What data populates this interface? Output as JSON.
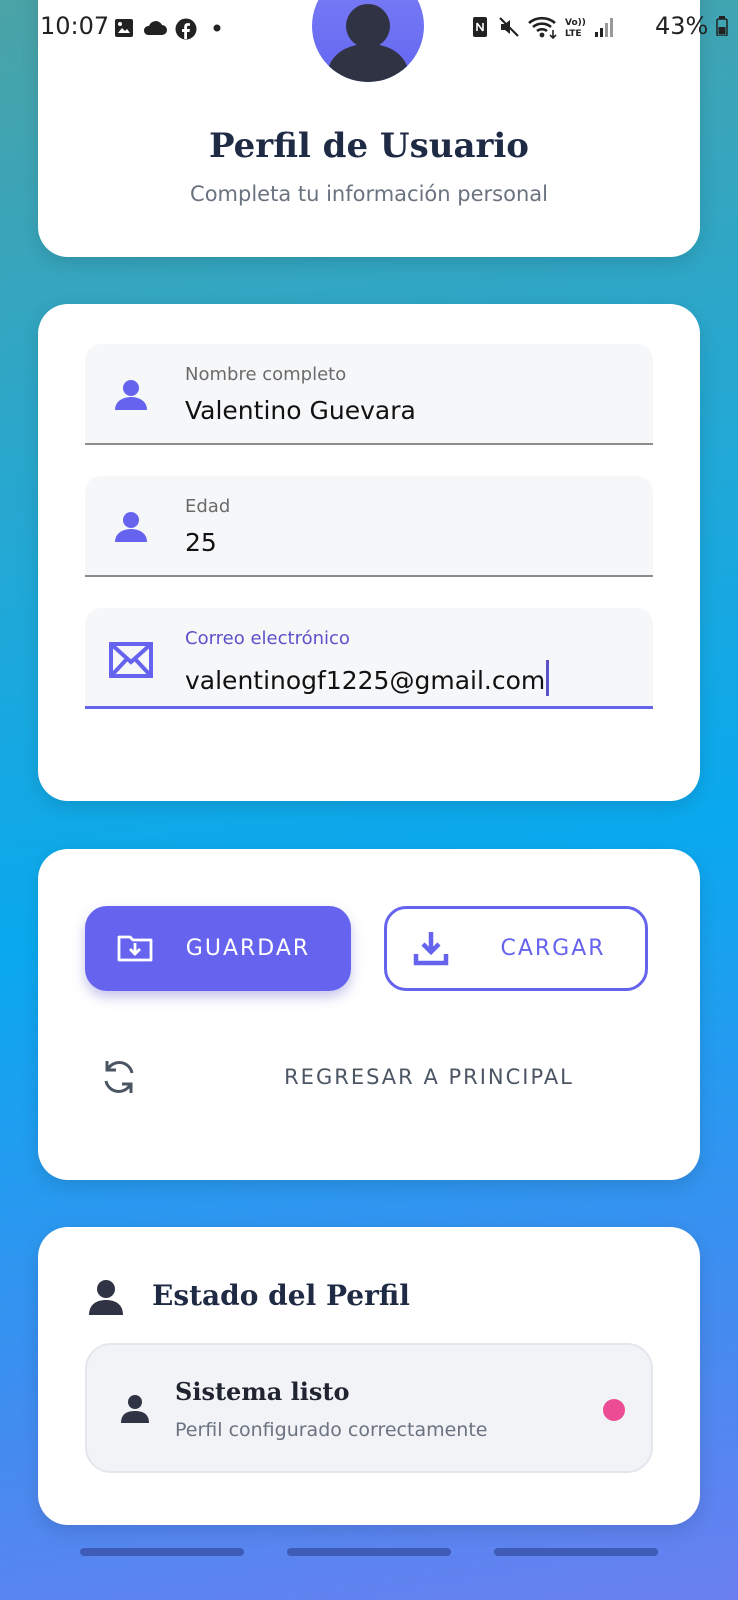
{
  "status_bar": {
    "time": "10:07",
    "battery": "43%",
    "icons": [
      "gallery-icon",
      "cloud-icon",
      "facebook-icon",
      "dot-icon",
      "nfc-icon",
      "mute-icon",
      "wifi-icon",
      "volte-icon",
      "signal-icon",
      "battery-icon"
    ]
  },
  "header": {
    "title": "Perfil de Usuario",
    "subtitle": "Completa tu información personal",
    "avatar_icon": "person-icon"
  },
  "form": {
    "name": {
      "label": "Nombre completo",
      "value": "Valentino Guevara",
      "icon": "person-icon"
    },
    "age": {
      "label": "Edad",
      "value": "25",
      "icon": "person-icon"
    },
    "email": {
      "label": "Correo electrónico",
      "value": "valentinogf1225@gmail.com",
      "icon": "mail-icon"
    }
  },
  "actions": {
    "save_label": "GUARDAR",
    "load_label": "CARGAR",
    "back_label": "REGRESAR A PRINCIPAL"
  },
  "status": {
    "title": "Estado del Perfil",
    "item_title": "Sistema listo",
    "item_subtitle": "Perfil configurado correctamente"
  },
  "colors": {
    "accent": "#6664ee",
    "status_dot": "#ec4c93",
    "title": "#1f2a44"
  }
}
